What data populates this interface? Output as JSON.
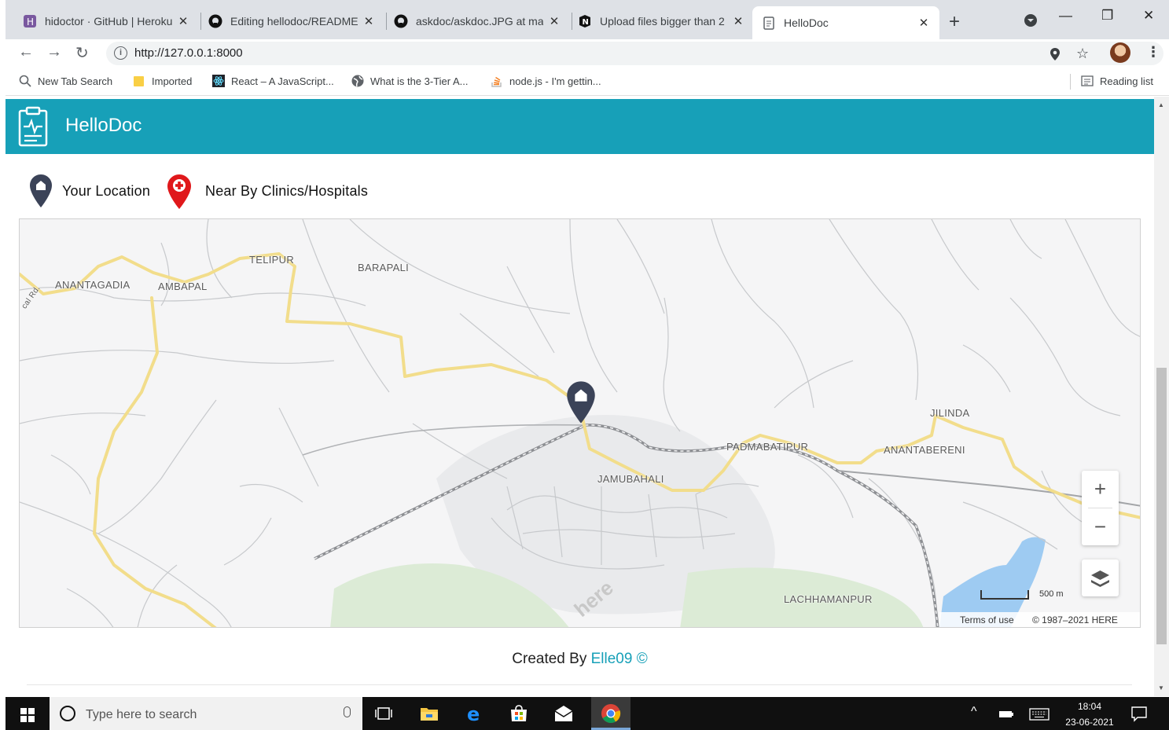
{
  "browser": {
    "tabs": [
      {
        "title": "hidoctor · GitHub | Heroku",
        "icon": "heroku-icon"
      },
      {
        "title": "Editing hellodoc/README",
        "icon": "github-icon"
      },
      {
        "title": "askdoc/askdoc.JPG at mai",
        "icon": "github-icon"
      },
      {
        "title": "Upload files bigger than 2",
        "icon": "notion-icon"
      },
      {
        "title": "HelloDoc",
        "icon": "document-icon"
      }
    ],
    "url": "http://127.0.0.1:8000",
    "bookmarks": [
      {
        "label": "New Tab Search",
        "icon": "search-icon"
      },
      {
        "label": "Imported",
        "icon": "folder-icon"
      },
      {
        "label": "React – A JavaScript...",
        "icon": "react-icon"
      },
      {
        "label": "What is the 3-Tier A...",
        "icon": "globe-icon"
      },
      {
        "label": "node.js - I'm gettin...",
        "icon": "stackoverflow-icon"
      }
    ],
    "reading_list": "Reading list"
  },
  "app": {
    "brand": "HelloDoc",
    "legend": {
      "your_location": "Your Location",
      "nearby": "Near By Clinics/Hospitals",
      "your_location_color": "#3b4358",
      "nearby_color": "#e0181b"
    },
    "map": {
      "places": [
        "TELIPUR",
        "BARAPALI",
        "ANANTAGADIA",
        "AMBAPAL",
        "JILINDA",
        "PADMABATIPUR",
        "ANANTABERENI",
        "JAMUBAHALI",
        "LACHHAMANPUR"
      ],
      "road_label": "cal Rd.",
      "scale": "500 m",
      "terms": "Terms of use",
      "copyright": "© 1987–2021 HERE",
      "watermark": "here",
      "zoom_in": "+",
      "zoom_out": "−"
    },
    "footer": {
      "prefix": "Created By",
      "author": "Elle09",
      "symbol": "©"
    }
  },
  "taskbar": {
    "search_placeholder": "Type here to search",
    "time": "18:04",
    "date": "23-06-2021"
  }
}
